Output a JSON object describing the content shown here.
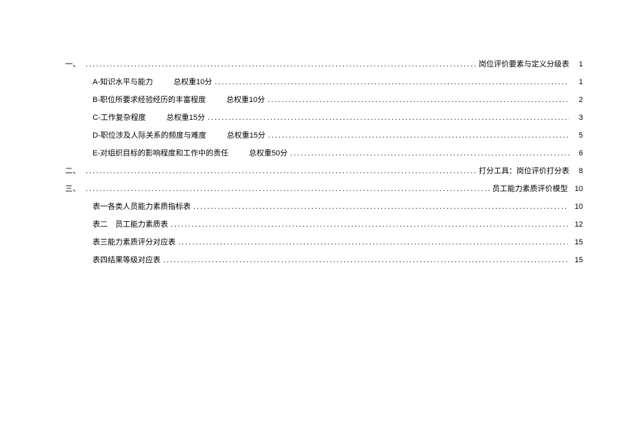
{
  "toc": {
    "entries": [
      {
        "level": 1,
        "number": "一、",
        "label": "",
        "weight": "",
        "right_title": "岗位评价要素与定义分级表",
        "page": "1"
      },
      {
        "level": 2,
        "number": "",
        "label": "A-知识水平与能力",
        "weight": "总权重10分",
        "right_title": "",
        "page": "1"
      },
      {
        "level": 2,
        "number": "",
        "label": "B-职位所要求经验经历的丰富程度",
        "weight": "总权重10分",
        "right_title": "",
        "page": "2"
      },
      {
        "level": 2,
        "number": "",
        "label": "C-工作复杂程度",
        "weight": "总权重15分",
        "right_title": "",
        "page": "3"
      },
      {
        "level": 2,
        "number": "",
        "label": "D-职位涉及人际关系的频度与难度",
        "weight": "总权重15分",
        "right_title": "",
        "page": "5"
      },
      {
        "level": 2,
        "number": "",
        "label": "E-对组织目标的影响程度和工作中的责任",
        "weight": "总权重50分",
        "right_title": "",
        "page": "6"
      },
      {
        "level": 1,
        "number": "二、",
        "label": "",
        "weight": "",
        "right_title": "打分工具：岗位评价打分表",
        "page": "8"
      },
      {
        "level": 1,
        "number": "三、",
        "label": "",
        "weight": "",
        "right_title": "员工能力素质评价模型",
        "page": "10"
      },
      {
        "level": 2,
        "number": "",
        "label": "表一各类人员能力素质指标表",
        "weight": "",
        "right_title": "",
        "page": "10"
      },
      {
        "level": 2,
        "number": "",
        "label": "表二　员工能力素质表",
        "weight": "",
        "right_title": "",
        "page": "12"
      },
      {
        "level": 2,
        "number": "",
        "label": "表三能力素质评分对应表",
        "weight": "",
        "right_title": "",
        "page": "15"
      },
      {
        "level": 2,
        "number": "",
        "label": "表四结果等级对应表",
        "weight": "",
        "right_title": "",
        "page": "15"
      }
    ]
  }
}
